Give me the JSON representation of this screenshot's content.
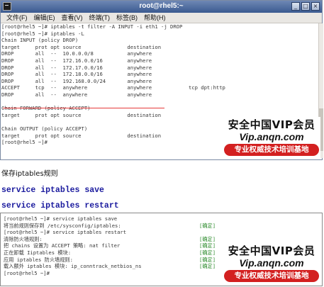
{
  "window": {
    "title": "root@rhel5:~",
    "buttons": [
      "_",
      "□",
      "×"
    ]
  },
  "menubar": [
    "文件(F)",
    "编辑(E)",
    "查看(V)",
    "终端(T)",
    "标签(B)",
    "帮助(H)"
  ],
  "terminal1": [
    "[root@rhel5 ~]# iptables -t filter -A INPUT -i eth1 -j DROP",
    "[root@rhel5 ~]# iptables -L",
    "Chain INPUT (policy DROP)",
    "target     prot opt source               destination",
    "DROP       all  --  10.0.0.0/8           anywhere",
    "DROP       all  --  172.16.0.0/16        anywhere",
    "DROP       all  --  172.17.0.0/16        anywhere",
    "DROP       all  --  172.18.0.0/16        anywhere",
    "DROP       all  --  192.168.0.0/24       anywhere",
    "ACCEPT     tcp  --  anywhere             anywhere            tcp dpt:http",
    "DROP       all  --  anywhere             anywhere",
    "",
    "Chain FORWARD (policy ACCEPT)",
    "target     prot opt source               destination",
    "",
    "Chain OUTPUT (policy ACCEPT)",
    "target     prot opt source               destination",
    "[root@rhel5 ~]# "
  ],
  "watermark": {
    "line1": "安全中国VIP会员",
    "line2": "Vip.anqn.com",
    "line3": "专业权威技术培训基地"
  },
  "caption": "保存iptables规则",
  "commands": {
    "save": "service iptables save",
    "restart": "service iptables restart"
  },
  "terminal2": [
    {
      "text": "[root@rhel5 ~]# service iptables save",
      "ok": ""
    },
    {
      "text": "将当前规则保存到 /etc/sysconfig/iptables:",
      "ok": "[确定]"
    },
    {
      "text": "[root@rhel5 ~]# service iptables restart",
      "ok": ""
    },
    {
      "text": "清除防火墙规则:",
      "ok": "[确定]"
    },
    {
      "text": "把 chains 设置为 ACCEPT 策略: nat filter",
      "ok": "[确定]"
    },
    {
      "text": "正在卸载 Iiptables 模块:",
      "ok": "[确定]"
    },
    {
      "text": "应用 iptables 防火墙规则:",
      "ok": "[确定]"
    },
    {
      "text": "载入额外 iptables 模块: ip_conntrack_netbios_ns",
      "ok": "[确定]"
    },
    {
      "text": "[root@rhel5 ~]# ",
      "ok": ""
    }
  ]
}
